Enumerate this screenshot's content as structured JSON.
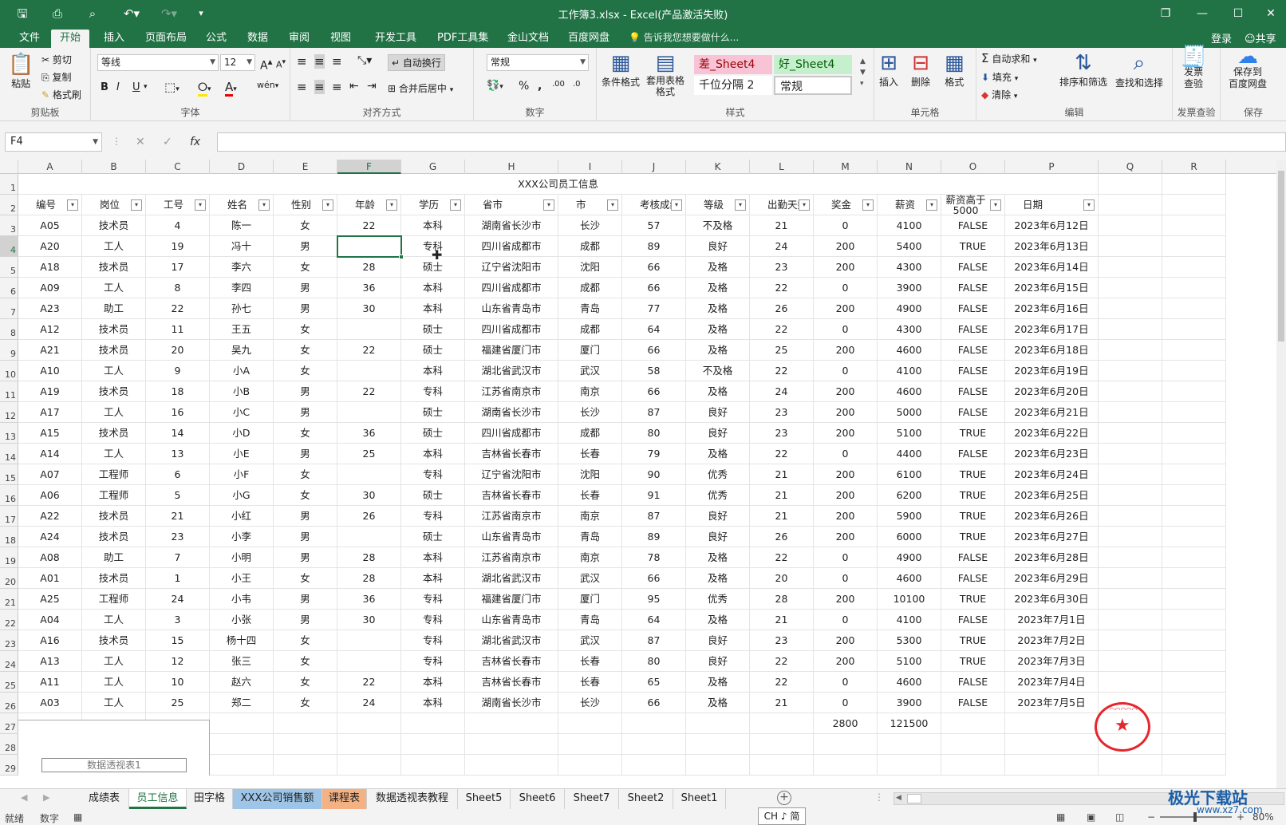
{
  "window": {
    "title": "工作簿3.xlsx - Excel(产品激活失败)",
    "quick_access": [
      "save-icon",
      "pdf-save-icon",
      "print-preview-icon",
      "undo-icon",
      "redo-icon",
      "customize-icon"
    ],
    "controls": [
      "ribbon-options-icon",
      "minimize-icon",
      "maximize-icon",
      "close-icon"
    ]
  },
  "ribbon_tabs": [
    "文件",
    "开始",
    "插入",
    "页面布局",
    "公式",
    "数据",
    "审阅",
    "视图",
    "开发工具",
    "PDF工具集",
    "金山文档",
    "百度网盘"
  ],
  "active_tab": "开始",
  "tell_me": "告诉我您想要做什么...",
  "login": "登录",
  "share": "共享",
  "ribbon": {
    "clipboard": {
      "paste": "粘贴",
      "cut": "剪切",
      "copy": "复制",
      "format_painter": "格式刷",
      "group": "剪贴板"
    },
    "font": {
      "name": "等线",
      "size": "12",
      "group": "字体",
      "bold": "B",
      "italic": "I",
      "underline": "U",
      "grow": "A",
      "shrink": "A",
      "font_color_sym": "A",
      "phonetic": "wén"
    },
    "alignment": {
      "wrap": "自动换行",
      "merge": "合并后居中",
      "group": "对齐方式"
    },
    "number": {
      "format": "常规",
      "group": "数字",
      "percent": "%",
      "comma": ",",
      "inc": ".00",
      "dec": ".0"
    },
    "styles": {
      "cond_format": "条件格式",
      "table_format": "套用表格格式",
      "bad": "差_Sheet4",
      "good": "好_Sheet4",
      "thousand": "千位分隔 2",
      "normal": "常规",
      "group": "样式"
    },
    "cells": {
      "insert": "插入",
      "delete": "删除",
      "format": "格式",
      "group": "单元格"
    },
    "editing": {
      "autosum": "自动求和",
      "fill": "填充",
      "clear": "清除",
      "sort": "排序和筛选",
      "find": "查找和选择",
      "group": "编辑"
    },
    "invoice": {
      "label1": "发票",
      "label2": "查验",
      "group": "发票查验"
    },
    "save": {
      "label1": "保存到",
      "label2": "百度网盘",
      "group": "保存"
    }
  },
  "formula_bar": {
    "name_box": "F4",
    "fx": "fx",
    "formula": ""
  },
  "column_letters": [
    "A",
    "B",
    "C",
    "D",
    "E",
    "F",
    "G",
    "H",
    "I",
    "J",
    "K",
    "L",
    "M",
    "N",
    "O",
    "P",
    "Q",
    "R"
  ],
  "selected_column": "F",
  "selected_row": 4,
  "row_numbers": [
    1,
    2,
    3,
    4,
    5,
    6,
    7,
    8,
    9,
    10,
    11,
    12,
    13,
    14,
    15,
    16,
    17,
    18,
    19,
    20,
    21,
    22,
    23,
    24,
    25,
    26,
    27,
    28,
    29
  ],
  "sheet_title": "XXX公司员工信息",
  "headers": [
    "编号",
    "岗位",
    "工号",
    "姓名",
    "性别",
    "年龄",
    "学历",
    "省市",
    "市",
    "考核成绩",
    "等级",
    "出勤天数",
    "奖金",
    "薪资",
    "薪资高于5000",
    "日期"
  ],
  "rows": [
    [
      "A05",
      "技术员",
      "4",
      "陈一",
      "女",
      "22",
      "本科",
      "湖南省长沙市",
      "长沙",
      "57",
      "不及格",
      "21",
      "0",
      "4100",
      "FALSE",
      "2023年6月12日"
    ],
    [
      "A20",
      "工人",
      "19",
      "冯十",
      "男",
      "",
      "专科",
      "四川省成都市",
      "成都",
      "89",
      "良好",
      "24",
      "200",
      "5400",
      "TRUE",
      "2023年6月13日"
    ],
    [
      "A18",
      "技术员",
      "17",
      "李六",
      "女",
      "28",
      "硕士",
      "辽宁省沈阳市",
      "沈阳",
      "66",
      "及格",
      "23",
      "200",
      "4300",
      "FALSE",
      "2023年6月14日"
    ],
    [
      "A09",
      "工人",
      "8",
      "李四",
      "男",
      "36",
      "本科",
      "四川省成都市",
      "成都",
      "66",
      "及格",
      "22",
      "0",
      "3900",
      "FALSE",
      "2023年6月15日"
    ],
    [
      "A23",
      "助工",
      "22",
      "孙七",
      "男",
      "30",
      "本科",
      "山东省青岛市",
      "青岛",
      "77",
      "及格",
      "26",
      "200",
      "4900",
      "FALSE",
      "2023年6月16日"
    ],
    [
      "A12",
      "技术员",
      "11",
      "王五",
      "女",
      "",
      "硕士",
      "四川省成都市",
      "成都",
      "64",
      "及格",
      "22",
      "0",
      "4300",
      "FALSE",
      "2023年6月17日"
    ],
    [
      "A21",
      "技术员",
      "20",
      "吴九",
      "女",
      "22",
      "硕士",
      "福建省厦门市",
      "厦门",
      "66",
      "及格",
      "25",
      "200",
      "4600",
      "FALSE",
      "2023年6月18日"
    ],
    [
      "A10",
      "工人",
      "9",
      "小A",
      "女",
      "",
      "本科",
      "湖北省武汉市",
      "武汉",
      "58",
      "不及格",
      "22",
      "0",
      "4100",
      "FALSE",
      "2023年6月19日"
    ],
    [
      "A19",
      "技术员",
      "18",
      "小B",
      "男",
      "22",
      "专科",
      "江苏省南京市",
      "南京",
      "66",
      "及格",
      "24",
      "200",
      "4600",
      "FALSE",
      "2023年6月20日"
    ],
    [
      "A17",
      "工人",
      "16",
      "小C",
      "男",
      "",
      "硕士",
      "湖南省长沙市",
      "长沙",
      "87",
      "良好",
      "23",
      "200",
      "5000",
      "FALSE",
      "2023年6月21日"
    ],
    [
      "A15",
      "技术员",
      "14",
      "小D",
      "女",
      "36",
      "硕士",
      "四川省成都市",
      "成都",
      "80",
      "良好",
      "23",
      "200",
      "5100",
      "TRUE",
      "2023年6月22日"
    ],
    [
      "A14",
      "工人",
      "13",
      "小E",
      "男",
      "25",
      "本科",
      "吉林省长春市",
      "长春",
      "79",
      "及格",
      "22",
      "0",
      "4400",
      "FALSE",
      "2023年6月23日"
    ],
    [
      "A07",
      "工程师",
      "6",
      "小F",
      "女",
      "",
      "专科",
      "辽宁省沈阳市",
      "沈阳",
      "90",
      "优秀",
      "21",
      "200",
      "6100",
      "TRUE",
      "2023年6月24日"
    ],
    [
      "A06",
      "工程师",
      "5",
      "小G",
      "女",
      "30",
      "硕士",
      "吉林省长春市",
      "长春",
      "91",
      "优秀",
      "21",
      "200",
      "6200",
      "TRUE",
      "2023年6月25日"
    ],
    [
      "A22",
      "技术员",
      "21",
      "小红",
      "男",
      "26",
      "专科",
      "江苏省南京市",
      "南京",
      "87",
      "良好",
      "21",
      "200",
      "5900",
      "TRUE",
      "2023年6月26日"
    ],
    [
      "A24",
      "技术员",
      "23",
      "小李",
      "男",
      "",
      "硕士",
      "山东省青岛市",
      "青岛",
      "89",
      "良好",
      "26",
      "200",
      "6000",
      "TRUE",
      "2023年6月27日"
    ],
    [
      "A08",
      "助工",
      "7",
      "小明",
      "男",
      "28",
      "本科",
      "江苏省南京市",
      "南京",
      "78",
      "及格",
      "22",
      "0",
      "4900",
      "FALSE",
      "2023年6月28日"
    ],
    [
      "A01",
      "技术员",
      "1",
      "小王",
      "女",
      "28",
      "本科",
      "湖北省武汉市",
      "武汉",
      "66",
      "及格",
      "20",
      "0",
      "4600",
      "FALSE",
      "2023年6月29日"
    ],
    [
      "A25",
      "工程师",
      "24",
      "小韦",
      "男",
      "36",
      "专科",
      "福建省厦门市",
      "厦门",
      "95",
      "优秀",
      "28",
      "200",
      "10100",
      "TRUE",
      "2023年6月30日"
    ],
    [
      "A04",
      "工人",
      "3",
      "小张",
      "男",
      "30",
      "专科",
      "山东省青岛市",
      "青岛",
      "64",
      "及格",
      "21",
      "0",
      "4100",
      "FALSE",
      "2023年7月1日"
    ],
    [
      "A16",
      "技术员",
      "15",
      "杨十四",
      "女",
      "",
      "专科",
      "湖北省武汉市",
      "武汉",
      "87",
      "良好",
      "23",
      "200",
      "5300",
      "TRUE",
      "2023年7月2日"
    ],
    [
      "A13",
      "工人",
      "12",
      "张三",
      "女",
      "",
      "专科",
      "吉林省长春市",
      "长春",
      "80",
      "良好",
      "22",
      "200",
      "5100",
      "TRUE",
      "2023年7月3日"
    ],
    [
      "A11",
      "工人",
      "10",
      "赵六",
      "女",
      "22",
      "本科",
      "吉林省长春市",
      "长春",
      "65",
      "及格",
      "22",
      "0",
      "4600",
      "FALSE",
      "2023年7月4日"
    ],
    [
      "A03",
      "工人",
      "25",
      "郑二",
      "女",
      "24",
      "本科",
      "湖南省长沙市",
      "长沙",
      "66",
      "及格",
      "21",
      "0",
      "3900",
      "FALSE",
      "2023年7月5日"
    ]
  ],
  "totals": {
    "bonus": "2800",
    "salary": "121500"
  },
  "pivot_label": "数据透视表1",
  "sheet_tabs": [
    {
      "label": "成绩表",
      "style": ""
    },
    {
      "label": "员工信息",
      "style": "active"
    },
    {
      "label": "田字格",
      "style": ""
    },
    {
      "label": "XXX公司销售额",
      "style": "blue"
    },
    {
      "label": "课程表",
      "style": "orange"
    },
    {
      "label": "数据透视表教程",
      "style": ""
    },
    {
      "label": "Sheet5",
      "style": ""
    },
    {
      "label": "Sheet6",
      "style": ""
    },
    {
      "label": "Sheet7",
      "style": ""
    },
    {
      "label": "Sheet2",
      "style": ""
    },
    {
      "label": "Sheet1",
      "style": ""
    }
  ],
  "status": {
    "ready": "就绪",
    "numlock": "数字",
    "ime": "CH ♪ 简",
    "zoom": "80%"
  },
  "watermark": {
    "name": "极光下载站",
    "url": "www.xz7.com"
  }
}
